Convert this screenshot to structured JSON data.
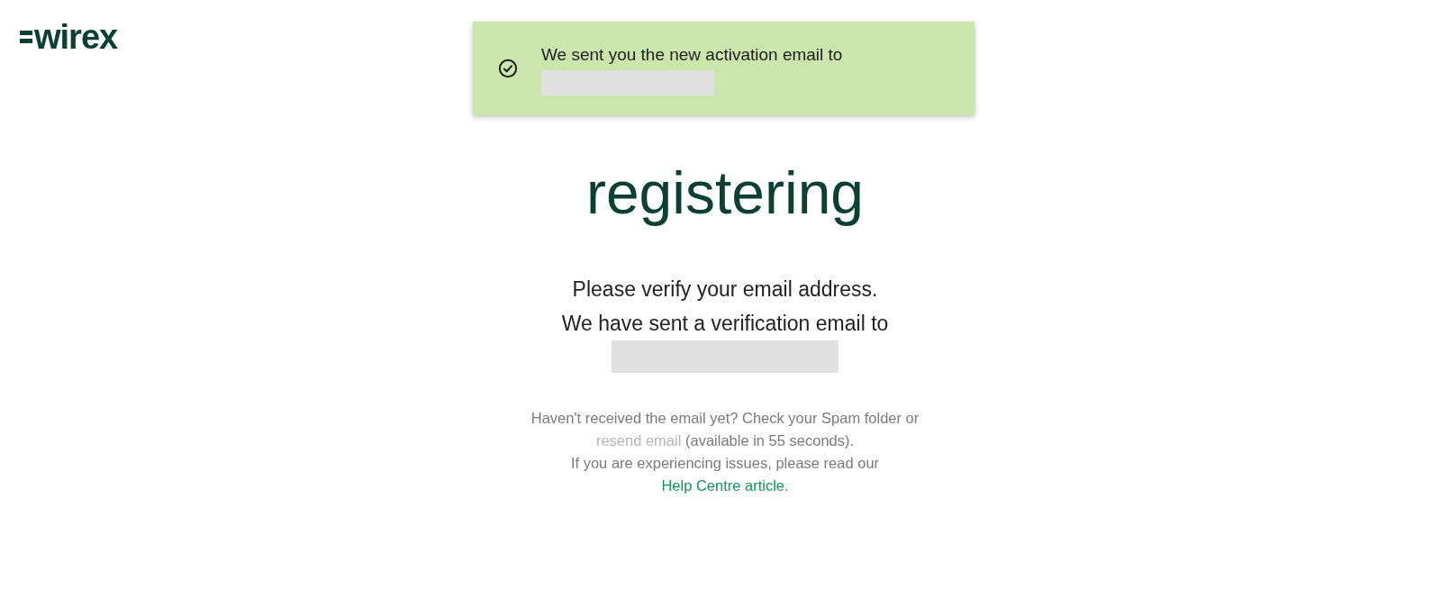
{
  "logo": "wirex",
  "toast": {
    "message": "We sent you the new activation email to",
    "email_redacted": true
  },
  "heading": "registering",
  "instructions": [
    "Please verify your email address.",
    "We have sent a verification email to"
  ],
  "email_redacted": true,
  "help": {
    "before_resend": "Haven't received the email yet? Check your Spam folder or",
    "resend_link": {
      "label": "resend email",
      "disabled": true
    },
    "after_resend": "(available in 55 seconds).",
    "issues_text": "If you are experiencing issues, please read our",
    "help_link": {
      "label": "Help Centre article",
      "disabled": false
    },
    "end": "."
  }
}
